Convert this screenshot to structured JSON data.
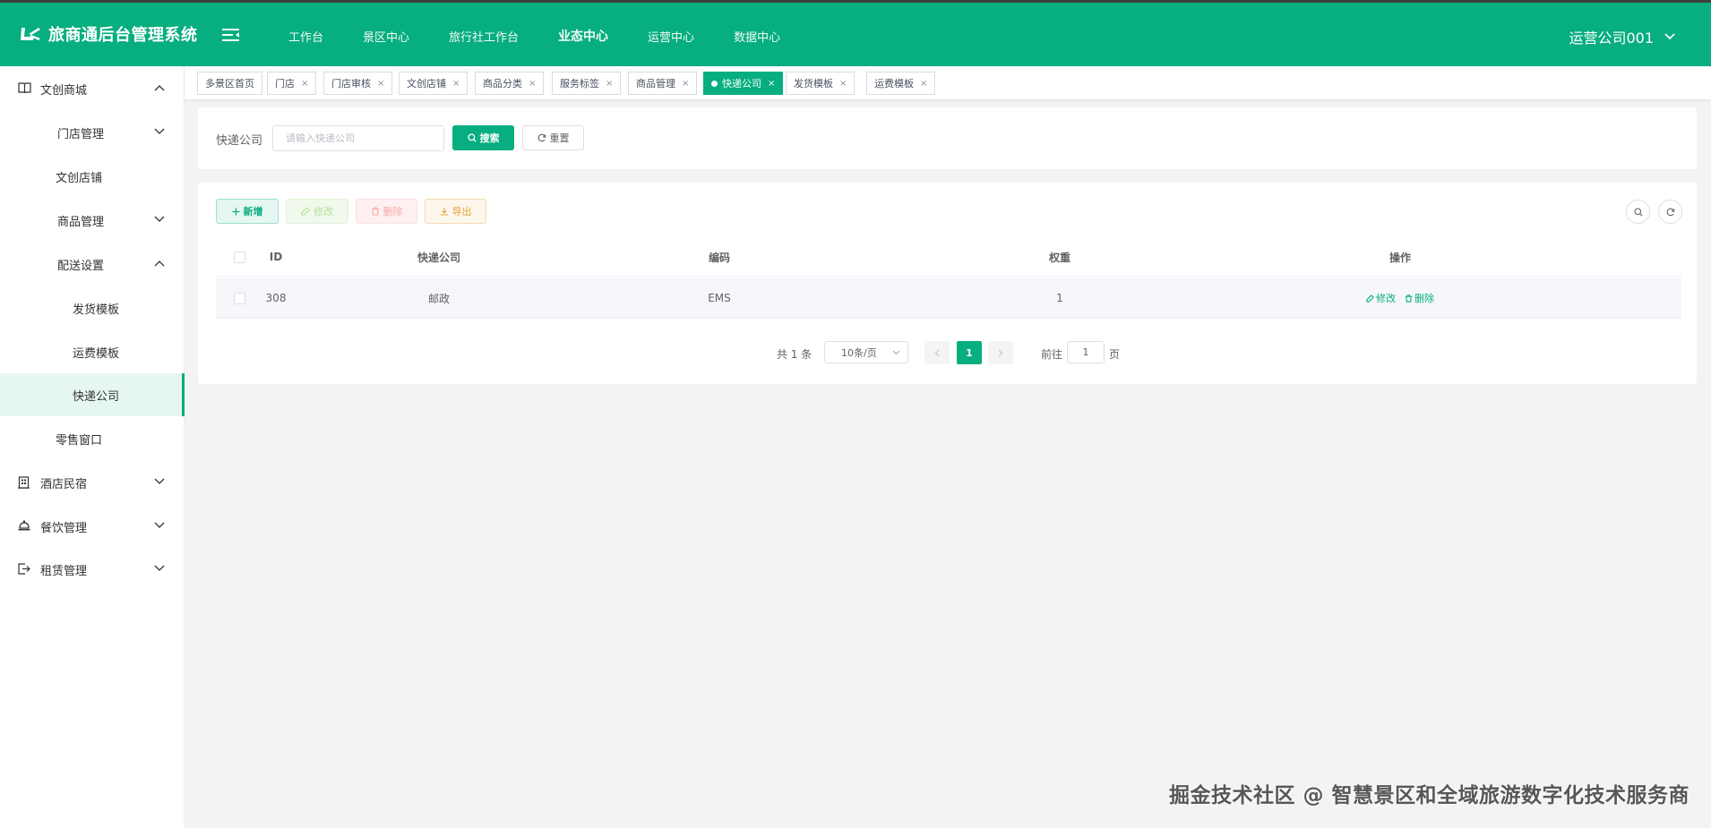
{
  "app": {
    "title": "旅商通后台管理系统"
  },
  "topnav": {
    "items": [
      {
        "label": "工作台"
      },
      {
        "label": "景区中心"
      },
      {
        "label": "旅行社工作台"
      },
      {
        "label": "业态中心",
        "active": true
      },
      {
        "label": "运营中心"
      },
      {
        "label": "数据中心"
      }
    ]
  },
  "user": {
    "name": "运营公司001"
  },
  "sidebar": {
    "items": [
      {
        "label": "文创商城",
        "level": 1,
        "icon": "book-icon",
        "expanded": true
      },
      {
        "label": "门店管理",
        "level": 2,
        "expanded": false
      },
      {
        "label": "文创店铺",
        "level": 2
      },
      {
        "label": "商品管理",
        "level": 2,
        "expanded": false
      },
      {
        "label": "配送设置",
        "level": 2,
        "expanded": true
      },
      {
        "label": "发货模板",
        "level": 3
      },
      {
        "label": "运费模板",
        "level": 3
      },
      {
        "label": "快递公司",
        "level": 3,
        "active": true
      },
      {
        "label": "零售窗口",
        "level": 2
      },
      {
        "label": "酒店民宿",
        "level": 1,
        "icon": "building-icon",
        "expanded": false
      },
      {
        "label": "餐饮管理",
        "level": 1,
        "icon": "bell-icon",
        "expanded": false
      },
      {
        "label": "租赁管理",
        "level": 1,
        "icon": "exit-icon",
        "expanded": false
      }
    ]
  },
  "tabs": [
    {
      "label": "多景区首页",
      "closable": false
    },
    {
      "label": "门店",
      "closable": true
    },
    {
      "label": "门店审核",
      "closable": true
    },
    {
      "label": "文创店铺",
      "closable": true
    },
    {
      "label": "商品分类",
      "closable": true
    },
    {
      "label": "服务标签",
      "closable": true
    },
    {
      "label": "商品管理",
      "closable": true
    },
    {
      "label": "快递公司",
      "closable": true,
      "active": true
    },
    {
      "label": "发货模板",
      "closable": true
    },
    {
      "label": "运费模板",
      "closable": true
    }
  ],
  "tab_close_glyph": "×",
  "search": {
    "label": "快递公司",
    "placeholder": "请输入快递公司",
    "value": "",
    "search_button": "搜索",
    "reset_button": "重置"
  },
  "toolbar": {
    "add": "新增",
    "edit": "修改",
    "delete": "删除",
    "export": "导出"
  },
  "table": {
    "columns": [
      "ID",
      "快递公司",
      "编码",
      "权重",
      "操作"
    ],
    "rows": [
      {
        "id": "308",
        "company": "邮政",
        "code": "EMS",
        "weight": "1"
      }
    ],
    "row_actions": {
      "edit": "修改",
      "delete": "删除"
    }
  },
  "pagination": {
    "total_text": "共 1 条",
    "page_size": "10条/页",
    "current_page": "1",
    "goto_prefix": "前往",
    "goto_value": "1",
    "goto_suffix": "页"
  },
  "watermark": "掘金技术社区 @ 智慧景区和全域旅游数字化技术服务商",
  "colors": {
    "primary": "#07ae7f",
    "header_bg": "#07ae7f",
    "page_bg": "#f3f3f3"
  }
}
